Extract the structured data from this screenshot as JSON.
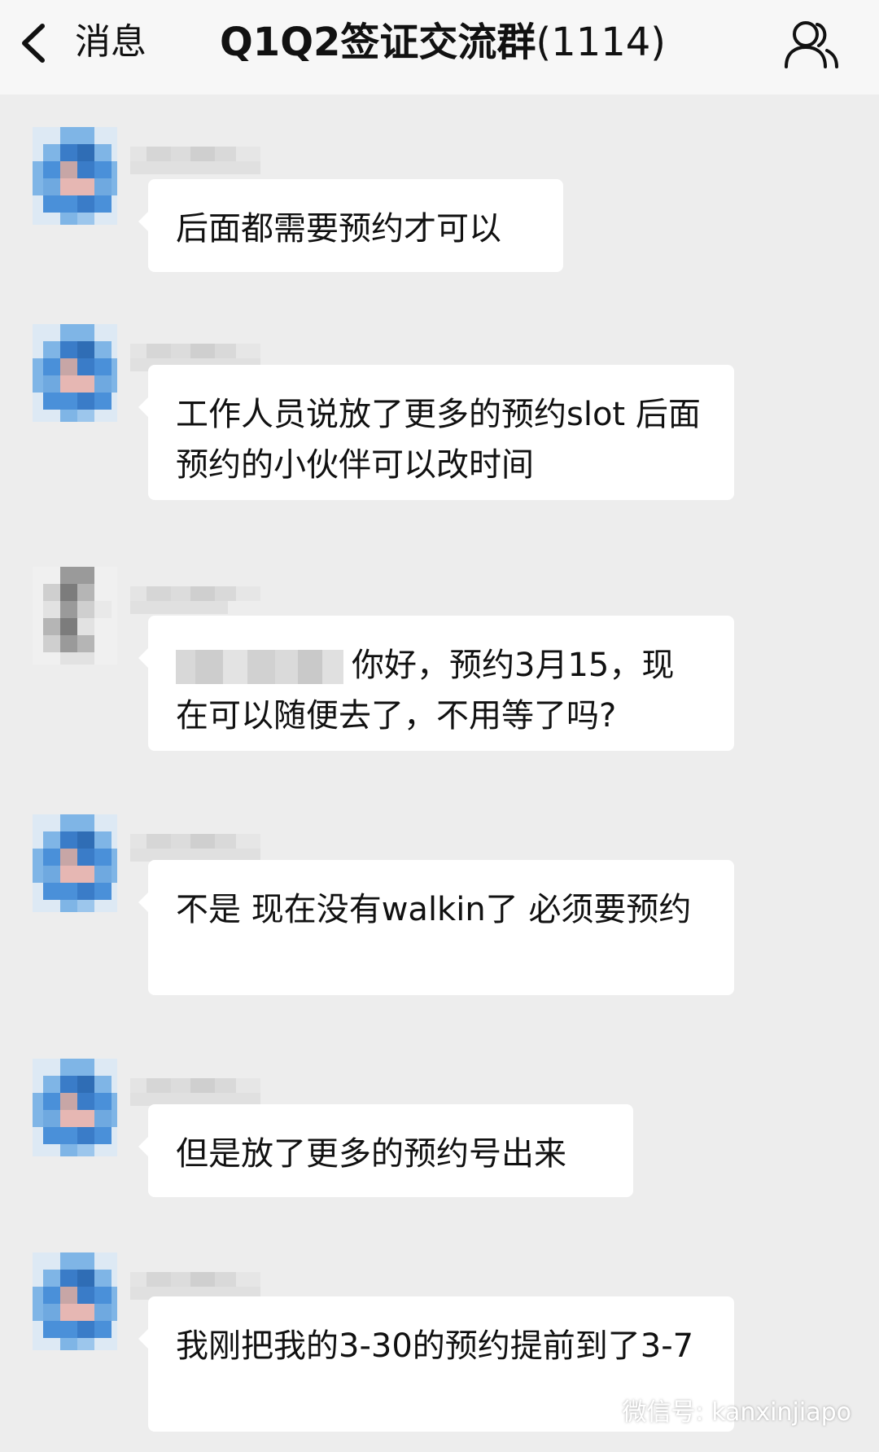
{
  "header": {
    "back_label": "消息",
    "title": "Q1Q2签证交流群",
    "member_count": "(1114)"
  },
  "messages": [
    {
      "text": "后面都需要预约才可以"
    },
    {
      "text": "工作人员说放了更多的预约slot 后面预约的小伙伴可以改时间"
    },
    {
      "mention": "",
      "text": "你好，预约3月15，现在可以随便去了，不用等了吗?"
    },
    {
      "text": "不是 现在没有walkin了 必须要预约"
    },
    {
      "text": "但是放了更多的预约号出来"
    },
    {
      "text": "我刚把我的3-30的预约提前到了3-7"
    }
  ],
  "watermark": {
    "text": "微信号: kanxinjiapo"
  },
  "colors": {
    "background": "#ededed",
    "header_bg": "#f7f7f7",
    "bubble_bg": "#ffffff",
    "avatar_blue": "#4a90d9"
  },
  "icons": {
    "back": "chevron-left-icon",
    "members": "group-members-icon",
    "watermark": "wechat-icon"
  }
}
